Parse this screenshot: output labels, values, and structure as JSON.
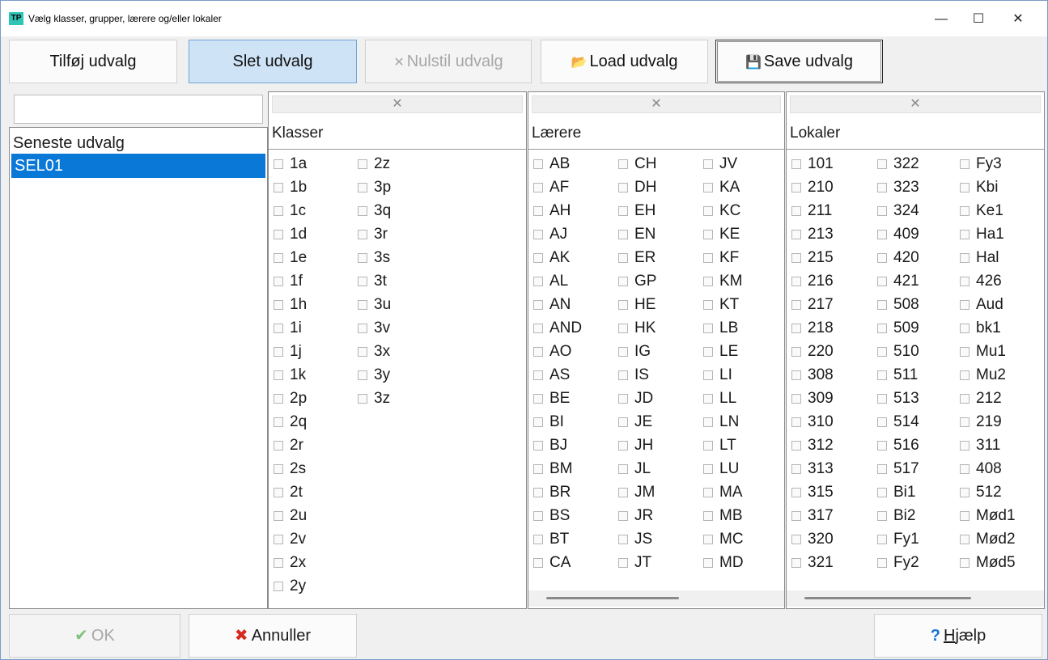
{
  "window": {
    "app_icon": "TP",
    "title": "Vælg klasser, grupper, lærere og/eller lokaler",
    "minimize": "—",
    "maximize": "☐",
    "close": "✕"
  },
  "toolbar": {
    "add": "Tilføj udvalg",
    "delete": "Slet udvalg",
    "reset": "Nulstil udvalg",
    "load": "Load udvalg",
    "save": "Save udvalg"
  },
  "left": {
    "search_value": "",
    "header": "Seneste udvalg",
    "items": [
      "SEL01"
    ]
  },
  "clear_glyph": "✕",
  "klasser": {
    "title": "Klasser",
    "items": [
      "1a",
      "1b",
      "1c",
      "1d",
      "1e",
      "1f",
      "1h",
      "1i",
      "1j",
      "1k",
      "2p",
      "2q",
      "2r",
      "2s",
      "2t",
      "2u",
      "2v",
      "2x",
      "2y",
      "2z",
      "3p",
      "3q",
      "3r",
      "3s",
      "3t",
      "3u",
      "3v",
      "3x",
      "3y",
      "3z"
    ]
  },
  "laerere": {
    "title": "Lærere",
    "items": [
      "AB",
      "AF",
      "AH",
      "AJ",
      "AK",
      "AL",
      "AN",
      "AND",
      "AO",
      "AS",
      "BE",
      "BI",
      "BJ",
      "BM",
      "BR",
      "BS",
      "BT",
      "CA",
      "CH",
      "DH",
      "EH",
      "EN",
      "ER",
      "GP",
      "HE",
      "HK",
      "IG",
      "IS",
      "JD",
      "JE",
      "JH",
      "JL",
      "JM",
      "JR",
      "JS",
      "JT",
      "JV",
      "KA",
      "KC",
      "KE",
      "KF",
      "KM",
      "KT",
      "LB",
      "LE",
      "LI",
      "LL",
      "LN",
      "LT",
      "LU",
      "MA",
      "MB",
      "MC",
      "MD"
    ]
  },
  "lokaler": {
    "title": "Lokaler",
    "items": [
      "101",
      "210",
      "211",
      "213",
      "215",
      "216",
      "217",
      "218",
      "220",
      "308",
      "309",
      "310",
      "312",
      "313",
      "315",
      "317",
      "320",
      "321",
      "322",
      "323",
      "324",
      "409",
      "420",
      "421",
      "508",
      "509",
      "510",
      "511",
      "513",
      "514",
      "516",
      "517",
      "Bi1",
      "Bi2",
      "Fy1",
      "Fy2",
      "Fy3",
      "Kbi",
      "Ke1",
      "Ha1",
      "Hal",
      "426",
      "Aud",
      "bk1",
      "Mu1",
      "Mu2",
      "212",
      "219",
      "311",
      "408",
      "512",
      "Mød1",
      "Mød2",
      "Mød5"
    ]
  },
  "bottom": {
    "ok": "OK",
    "cancel": "Annuller",
    "help_first": "H",
    "help_rest": "jælp"
  }
}
